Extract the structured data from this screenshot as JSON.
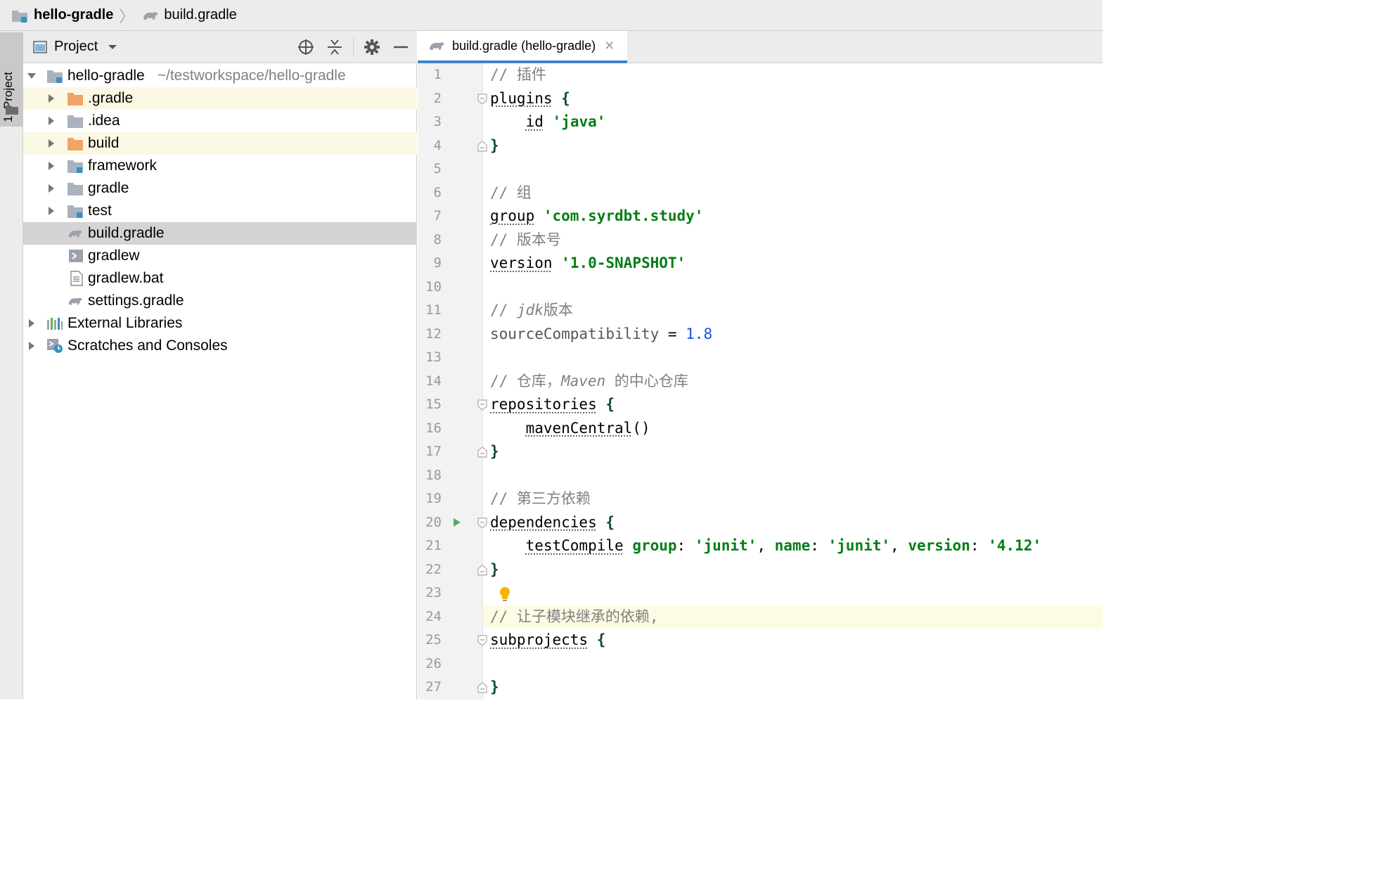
{
  "breadcrumb": {
    "project": "hello-gradle",
    "file": "build.gradle"
  },
  "tool_stripe": {
    "project_tab": "1: Project"
  },
  "project_panel": {
    "title": "Project",
    "tools": [
      "locate-icon",
      "collapse-all-icon",
      "gear-icon",
      "minimize-icon"
    ],
    "tree": {
      "root": {
        "label": "hello-gradle",
        "path": "~/testworkspace/hello-gradle"
      },
      "items": [
        {
          "label": ".gradle",
          "type": "folder-excluded"
        },
        {
          "label": ".idea",
          "type": "folder"
        },
        {
          "label": "build",
          "type": "folder-excluded"
        },
        {
          "label": "framework",
          "type": "module"
        },
        {
          "label": "gradle",
          "type": "folder"
        },
        {
          "label": "test",
          "type": "module"
        },
        {
          "label": "build.gradle",
          "type": "gradle-file"
        },
        {
          "label": "gradlew",
          "type": "shell-file"
        },
        {
          "label": "gradlew.bat",
          "type": "text-file"
        },
        {
          "label": "settings.gradle",
          "type": "gradle-file"
        }
      ],
      "external_libraries": "External Libraries",
      "scratches": "Scratches and Consoles"
    }
  },
  "editor": {
    "tab_label": "build.gradle (hello-gradle)",
    "current_line": 24,
    "lines": [
      {
        "n": "1"
      },
      {
        "n": "2"
      },
      {
        "n": "3"
      },
      {
        "n": "4"
      },
      {
        "n": "5"
      },
      {
        "n": "6"
      },
      {
        "n": "7"
      },
      {
        "n": "8"
      },
      {
        "n": "9"
      },
      {
        "n": "10"
      },
      {
        "n": "11"
      },
      {
        "n": "12"
      },
      {
        "n": "13"
      },
      {
        "n": "14"
      },
      {
        "n": "15"
      },
      {
        "n": "16"
      },
      {
        "n": "17"
      },
      {
        "n": "18"
      },
      {
        "n": "19"
      },
      {
        "n": "20"
      },
      {
        "n": "21"
      },
      {
        "n": "22"
      },
      {
        "n": "23"
      },
      {
        "n": "24"
      },
      {
        "n": "25"
      },
      {
        "n": "26"
      },
      {
        "n": "27"
      }
    ],
    "code": {
      "l1_comment": "// 插件",
      "l2_kw": "plugins",
      "brace_open": " {",
      "brace_close": "}",
      "l3_kw": "id",
      "l3_str": "'java'",
      "l6_comment": "// 组",
      "l7_kw": "group",
      "l7_str": "'com.syrdbt.study'",
      "l8_comment": "// 版本号",
      "l9_kw": "version",
      "l9_str": "'1.0-SNAPSHOT'",
      "l11_comment_a": "// ",
      "l11_comment_b": "jdk",
      "l11_comment_c": "版本",
      "l12_name": "sourceCompatibility",
      "l12_eq": " = ",
      "l12_num": "1.8",
      "l14_comment_a": "// 仓库，",
      "l14_comment_b": "Maven",
      "l14_comment_c": " 的中心仓库",
      "l15_kw": "repositories",
      "l16_kw": "mavenCentral",
      "l16_parens": "()",
      "l19_comment": "// 第三方依赖",
      "l20_kw": "dependencies",
      "l21_kw": "testCompile",
      "l21_group": "group",
      "l21_group_val": "'junit'",
      "l21_name": "name",
      "l21_name_val": "'junit'",
      "l21_version": "version",
      "l21_version_val": "'4.12'",
      "colon": ": ",
      "comma": ", ",
      "l24_comment": "// 让子模块继承的依赖,",
      "l25_kw": "subprojects"
    }
  },
  "colors": {
    "selection": "#d4d4d4",
    "excluded_highlight": "#fbf9e3",
    "tab_underline": "#4083c9",
    "string": "#067d17",
    "number": "#1750eb",
    "comment": "#808080"
  }
}
